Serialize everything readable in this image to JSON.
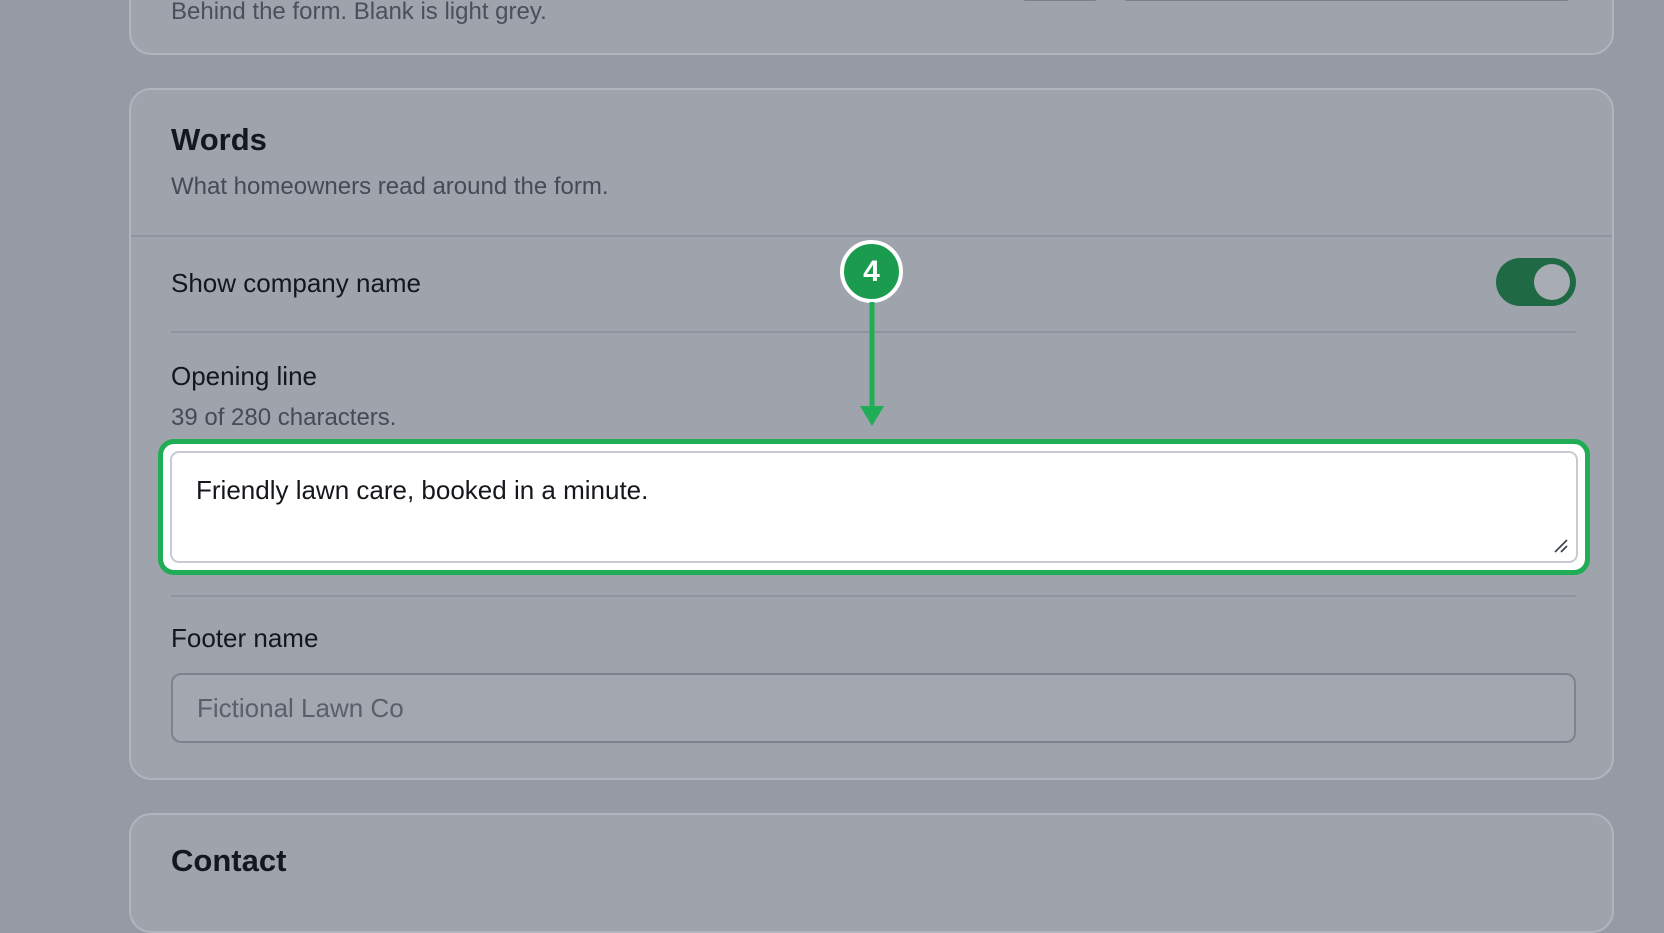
{
  "background_section": {
    "hint": "Behind the form. Blank is light grey."
  },
  "words_section": {
    "title": "Words",
    "subtitle": "What homeowners read around the form.",
    "show_company_name": {
      "label": "Show company name",
      "enabled": true
    },
    "opening_line": {
      "label": "Opening line",
      "char_count": "39 of 280 characters.",
      "value": "Friendly lawn care, booked in a minute."
    },
    "footer_name": {
      "label": "Footer name",
      "placeholder": "Fictional Lawn Co"
    }
  },
  "contact_section": {
    "title": "Contact"
  },
  "annotation": {
    "step_number": "4"
  },
  "colors": {
    "highlight": "#1fad55",
    "toggle_on": "#1f6a45",
    "badge": "#1b9b4d",
    "overlay_background": "#959aa4"
  },
  "icons": {
    "resize_handle": "resize-grip-icon",
    "arrow": "arrow-down-icon"
  }
}
